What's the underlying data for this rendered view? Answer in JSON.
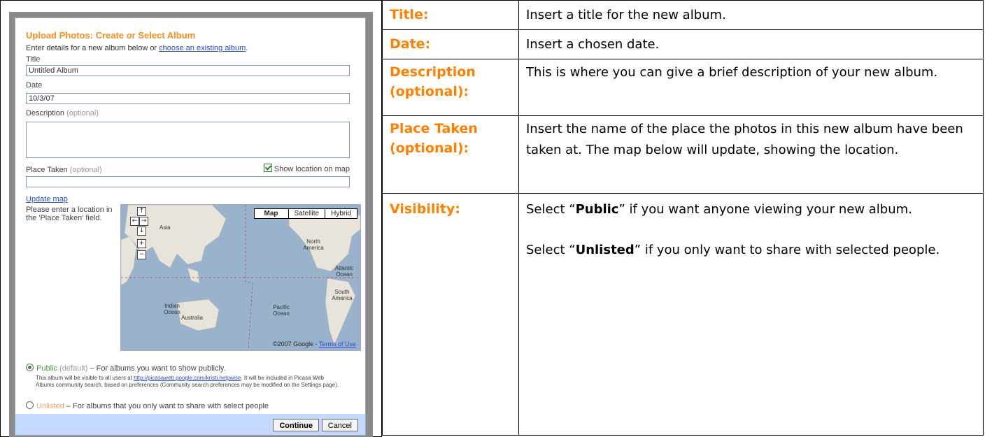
{
  "form": {
    "heading": "Upload Photos: Create or Select Album",
    "intro_text": "Enter details for a new album below or ",
    "intro_link": "choose an existing album",
    "intro_end": ".",
    "title_label": "Title",
    "title_value": "Untitled Album",
    "date_label": "Date",
    "date_value": "10/3/07",
    "description_label": "Description",
    "description_optional": "(optional)",
    "place_label": "Place Taken",
    "place_optional": "(optional)",
    "show_location_label": "Show location on map",
    "update_map_link": "Update map",
    "map_note": "Please enter a location in the 'Place Taken' field.",
    "map": {
      "buttons": [
        "Map",
        "Satellite",
        "Hybrid"
      ],
      "labels": {
        "asia": "Asia",
        "north_america": "North America",
        "atlantic": "Atlantic Ocean",
        "south_america": "South America",
        "indian": "Indian Ocean",
        "australia": "Australia",
        "pacific": "Pacific Ocean"
      },
      "copyright": "©2007 Google - ",
      "terms": "Terms of Use",
      "pan_up": "↑",
      "pan_left": "←",
      "pan_right": "→",
      "pan_down": "↓",
      "zoom_in": "+",
      "zoom_out": "−"
    },
    "public_label": "Public",
    "public_default": "(default)",
    "public_desc": " – For albums you want to show publicly.",
    "public_note_1": "This album will be visible to all users at ",
    "public_note_link": "http://picasaweb.google.com/kristi.helpwise",
    "public_note_2": ". It will be included in Picasa Web Albums community search, based on preferences (Community search preferences may be modified on the Settings page).",
    "unlisted_label": "Unlisted",
    "unlisted_desc": " – For albums that you only want to share with select people",
    "continue_button": "Continue",
    "cancel_button": "Cancel"
  },
  "info_table": {
    "rows": [
      {
        "term": "Title:",
        "desc": "Insert a title for the new album."
      },
      {
        "term": "Date:",
        "desc": "Insert a chosen date."
      },
      {
        "term": "Description (optional):",
        "desc": "This is where you can give a brief description of your new album."
      },
      {
        "term": "Place Taken (optional):",
        "desc": "Insert the name of the place the photos in this new album have been taken at. The map below will update, showing the location."
      },
      {
        "term": "Visibility:",
        "desc_public_pre": "Select “",
        "desc_public_bold": "Public",
        "desc_public_post": "” if you want anyone viewing your new album.",
        "desc_unlisted_pre": "Select “",
        "desc_unlisted_bold": "Unlisted",
        "desc_unlisted_post": "” if you only want to share with selected people."
      }
    ]
  },
  "colors": {
    "heading_orange": "#ff8c1a",
    "term_orange": "#ff8000",
    "footer_blue": "#c3d9ff",
    "map_water": "#99b3cc",
    "map_land": "#e8e4dc",
    "link_blue": "#2a4bd0"
  },
  "icons": {
    "checkbox": "checkbox-checked-icon",
    "radio_selected": "radio-selected-icon",
    "radio_unselected": "radio-unselected-icon"
  }
}
